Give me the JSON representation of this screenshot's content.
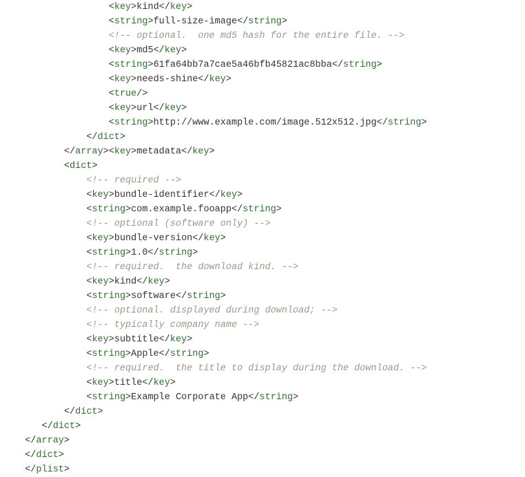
{
  "lines": [
    {
      "indent": 17,
      "tokens": [
        [
          "p",
          "<"
        ],
        [
          "nt",
          "key"
        ],
        [
          "p",
          ">"
        ],
        [
          "s",
          "kind"
        ],
        [
          "p",
          "</"
        ],
        [
          "nt",
          "key"
        ],
        [
          "p",
          ">"
        ]
      ]
    },
    {
      "indent": 17,
      "tokens": [
        [
          "p",
          "<"
        ],
        [
          "nt",
          "string"
        ],
        [
          "p",
          ">"
        ],
        [
          "s",
          "full-size-image"
        ],
        [
          "p",
          "</"
        ],
        [
          "nt",
          "string"
        ],
        [
          "p",
          ">"
        ]
      ]
    },
    {
      "indent": 17,
      "tokens": [
        [
          "c",
          "<!-- optional.  one md5 hash for the entire file. -->"
        ]
      ]
    },
    {
      "indent": 17,
      "tokens": [
        [
          "p",
          "<"
        ],
        [
          "nt",
          "key"
        ],
        [
          "p",
          ">"
        ],
        [
          "s",
          "md5"
        ],
        [
          "p",
          "</"
        ],
        [
          "nt",
          "key"
        ],
        [
          "p",
          ">"
        ]
      ]
    },
    {
      "indent": 17,
      "tokens": [
        [
          "p",
          "<"
        ],
        [
          "nt",
          "string"
        ],
        [
          "p",
          ">"
        ],
        [
          "s",
          "61fa64bb7a7cae5a46bfb45821ac8bba"
        ],
        [
          "p",
          "</"
        ],
        [
          "nt",
          "string"
        ],
        [
          "p",
          ">"
        ]
      ]
    },
    {
      "indent": 17,
      "tokens": [
        [
          "p",
          "<"
        ],
        [
          "nt",
          "key"
        ],
        [
          "p",
          ">"
        ],
        [
          "s",
          "needs-shine"
        ],
        [
          "p",
          "</"
        ],
        [
          "nt",
          "key"
        ],
        [
          "p",
          ">"
        ]
      ]
    },
    {
      "indent": 17,
      "tokens": [
        [
          "p",
          "<"
        ],
        [
          "nt",
          "true"
        ],
        [
          "p",
          "/>"
        ]
      ]
    },
    {
      "indent": 17,
      "tokens": [
        [
          "p",
          "<"
        ],
        [
          "nt",
          "key"
        ],
        [
          "p",
          ">"
        ],
        [
          "s",
          "url"
        ],
        [
          "p",
          "</"
        ],
        [
          "nt",
          "key"
        ],
        [
          "p",
          ">"
        ]
      ]
    },
    {
      "indent": 17,
      "tokens": [
        [
          "p",
          "<"
        ],
        [
          "nt",
          "string"
        ],
        [
          "p",
          ">"
        ],
        [
          "s",
          "http://www.example.com/image.512x512.jpg"
        ],
        [
          "p",
          "</"
        ],
        [
          "nt",
          "string"
        ],
        [
          "p",
          ">"
        ]
      ]
    },
    {
      "indent": 13,
      "tokens": [
        [
          "p",
          "</"
        ],
        [
          "nt",
          "dict"
        ],
        [
          "p",
          ">"
        ]
      ]
    },
    {
      "indent": 9,
      "tokens": [
        [
          "p",
          "</"
        ],
        [
          "nt",
          "array"
        ],
        [
          "p",
          ">"
        ],
        [
          "p",
          "<"
        ],
        [
          "nt",
          "key"
        ],
        [
          "p",
          ">"
        ],
        [
          "s",
          "metadata"
        ],
        [
          "p",
          "</"
        ],
        [
          "nt",
          "key"
        ],
        [
          "p",
          ">"
        ]
      ]
    },
    {
      "indent": 9,
      "tokens": [
        [
          "p",
          "<"
        ],
        [
          "nt",
          "dict"
        ],
        [
          "p",
          ">"
        ]
      ]
    },
    {
      "indent": 13,
      "tokens": [
        [
          "c",
          "<!-- required -->"
        ]
      ]
    },
    {
      "indent": 13,
      "tokens": [
        [
          "p",
          "<"
        ],
        [
          "nt",
          "key"
        ],
        [
          "p",
          ">"
        ],
        [
          "s",
          "bundle-identifier"
        ],
        [
          "p",
          "</"
        ],
        [
          "nt",
          "key"
        ],
        [
          "p",
          ">"
        ]
      ]
    },
    {
      "indent": 13,
      "tokens": [
        [
          "p",
          "<"
        ],
        [
          "nt",
          "string"
        ],
        [
          "p",
          ">"
        ],
        [
          "s",
          "com.example.fooapp"
        ],
        [
          "p",
          "</"
        ],
        [
          "nt",
          "string"
        ],
        [
          "p",
          ">"
        ]
      ]
    },
    {
      "indent": 13,
      "tokens": [
        [
          "c",
          "<!-- optional (software only) -->"
        ]
      ]
    },
    {
      "indent": 13,
      "tokens": [
        [
          "p",
          "<"
        ],
        [
          "nt",
          "key"
        ],
        [
          "p",
          ">"
        ],
        [
          "s",
          "bundle-version"
        ],
        [
          "p",
          "</"
        ],
        [
          "nt",
          "key"
        ],
        [
          "p",
          ">"
        ]
      ]
    },
    {
      "indent": 13,
      "tokens": [
        [
          "p",
          "<"
        ],
        [
          "nt",
          "string"
        ],
        [
          "p",
          ">"
        ],
        [
          "s",
          "1.0"
        ],
        [
          "p",
          "</"
        ],
        [
          "nt",
          "string"
        ],
        [
          "p",
          ">"
        ]
      ]
    },
    {
      "indent": 13,
      "tokens": [
        [
          "c",
          "<!-- required.  the download kind. -->"
        ]
      ]
    },
    {
      "indent": 13,
      "tokens": [
        [
          "p",
          "<"
        ],
        [
          "nt",
          "key"
        ],
        [
          "p",
          ">"
        ],
        [
          "s",
          "kind"
        ],
        [
          "p",
          "</"
        ],
        [
          "nt",
          "key"
        ],
        [
          "p",
          ">"
        ]
      ]
    },
    {
      "indent": 13,
      "tokens": [
        [
          "p",
          "<"
        ],
        [
          "nt",
          "string"
        ],
        [
          "p",
          ">"
        ],
        [
          "s",
          "software"
        ],
        [
          "p",
          "</"
        ],
        [
          "nt",
          "string"
        ],
        [
          "p",
          ">"
        ]
      ]
    },
    {
      "indent": 13,
      "tokens": [
        [
          "c",
          "<!-- optional. displayed during download; -->"
        ]
      ]
    },
    {
      "indent": 13,
      "tokens": [
        [
          "c",
          "<!-- typically company name -->"
        ]
      ]
    },
    {
      "indent": 13,
      "tokens": [
        [
          "p",
          "<"
        ],
        [
          "nt",
          "key"
        ],
        [
          "p",
          ">"
        ],
        [
          "s",
          "subtitle"
        ],
        [
          "p",
          "</"
        ],
        [
          "nt",
          "key"
        ],
        [
          "p",
          ">"
        ]
      ]
    },
    {
      "indent": 13,
      "tokens": [
        [
          "p",
          "<"
        ],
        [
          "nt",
          "string"
        ],
        [
          "p",
          ">"
        ],
        [
          "s",
          "Apple"
        ],
        [
          "p",
          "</"
        ],
        [
          "nt",
          "string"
        ],
        [
          "p",
          ">"
        ]
      ]
    },
    {
      "indent": 13,
      "tokens": [
        [
          "c",
          "<!-- required.  the title to display during the download. -->"
        ]
      ]
    },
    {
      "indent": 13,
      "tokens": [
        [
          "p",
          "<"
        ],
        [
          "nt",
          "key"
        ],
        [
          "p",
          ">"
        ],
        [
          "s",
          "title"
        ],
        [
          "p",
          "</"
        ],
        [
          "nt",
          "key"
        ],
        [
          "p",
          ">"
        ]
      ]
    },
    {
      "indent": 13,
      "tokens": [
        [
          "p",
          "<"
        ],
        [
          "nt",
          "string"
        ],
        [
          "p",
          ">"
        ],
        [
          "s",
          "Example Corporate App"
        ],
        [
          "p",
          "</"
        ],
        [
          "nt",
          "string"
        ],
        [
          "p",
          ">"
        ]
      ]
    },
    {
      "indent": 9,
      "tokens": [
        [
          "p",
          "</"
        ],
        [
          "nt",
          "dict"
        ],
        [
          "p",
          ">"
        ]
      ]
    },
    {
      "indent": 5,
      "tokens": [
        [
          "p",
          "</"
        ],
        [
          "nt",
          "dict"
        ],
        [
          "p",
          ">"
        ]
      ]
    },
    {
      "indent": 2,
      "tokens": [
        [
          "p",
          "</"
        ],
        [
          "nt",
          "array"
        ],
        [
          "p",
          ">"
        ]
      ]
    },
    {
      "indent": 2,
      "tokens": [
        [
          "p",
          "</"
        ],
        [
          "nt",
          "dict"
        ],
        [
          "p",
          ">"
        ]
      ]
    },
    {
      "indent": 2,
      "tokens": [
        [
          "p",
          "</"
        ],
        [
          "nt",
          "plist"
        ],
        [
          "p",
          ">"
        ]
      ]
    }
  ]
}
